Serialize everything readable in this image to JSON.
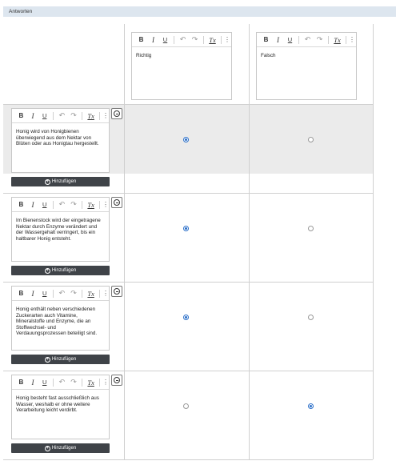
{
  "section": {
    "title": "Antworten"
  },
  "toolbar": {
    "bold": "B",
    "italic": "I",
    "underline": "U",
    "undo": "↶",
    "redo": "↷",
    "clear_format": "Tx",
    "more": "⋮"
  },
  "columns": [
    {
      "label": "Richtig"
    },
    {
      "label": "Falsch"
    }
  ],
  "rows": [
    {
      "text": "Honig wird von Honigbienen überwiegend aus dem Nektar von Blüten oder aus Honigtau hergestellt.",
      "selected": "Richtig"
    },
    {
      "text": "Im Bienenstock wird der eingetragene Nektar durch Enzyme verändert und der Wassergehalt verringert, bis ein haltbarer Honig entsteht.",
      "selected": "Richtig"
    },
    {
      "text": "Honig enthält neben verschiedenen Zuckerarten auch Vitamine, Mineralstoffe und Enzyme, die an Stoffwechsel- und Verdauungsprozessen beteiligt sind.",
      "selected": "Richtig"
    },
    {
      "text": "Honig besteht fast ausschließlich aus Wasser, weshalb er ohne weitere Verarbeitung leicht verdirbt.",
      "selected": "Falsch"
    }
  ],
  "add_button": {
    "label": "Hinzufügen"
  },
  "colors": {
    "accent": "#2b6fc9",
    "button_dark": "#3f4348",
    "row_shade": "#ebebeb",
    "header_bg": "#dde6ef"
  }
}
